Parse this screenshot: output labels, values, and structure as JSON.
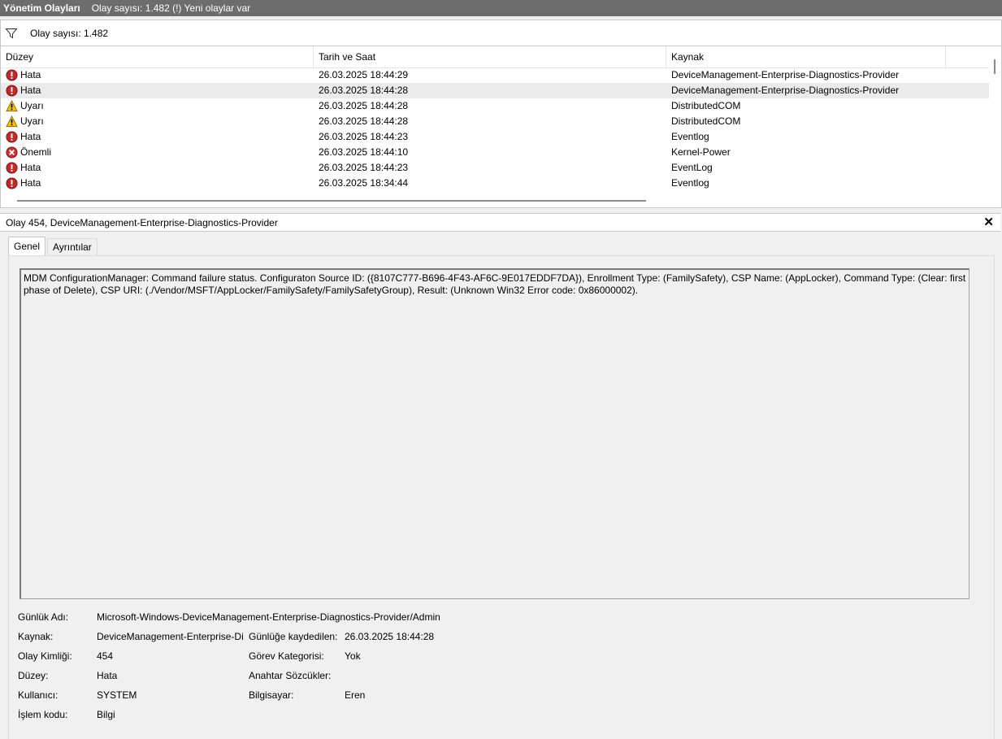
{
  "titlebar": {
    "title": "Yönetim Olayları",
    "status": "Olay sayısı: 1.482 (!) Yeni olaylar var"
  },
  "filterbar": {
    "icon": "filter-icon",
    "count_text": "Olay sayısı: 1.482"
  },
  "grid": {
    "columns": [
      "Düzey",
      "Tarih ve Saat",
      "Kaynak"
    ],
    "rows": [
      {
        "level": "Hata",
        "level_icon": "error-icon",
        "datetime": "26.03.2025 18:44:29",
        "source": "DeviceManagement-Enterprise-Diagnostics-Provider"
      },
      {
        "level": "Hata",
        "level_icon": "error-icon",
        "datetime": "26.03.2025 18:44:28",
        "source": "DeviceManagement-Enterprise-Diagnostics-Provider"
      },
      {
        "level": "Uyarı",
        "level_icon": "warning-icon",
        "datetime": "26.03.2025 18:44:28",
        "source": "DistributedCOM"
      },
      {
        "level": "Uyarı",
        "level_icon": "warning-icon",
        "datetime": "26.03.2025 18:44:28",
        "source": "DistributedCOM"
      },
      {
        "level": "Hata",
        "level_icon": "error-icon",
        "datetime": "26.03.2025 18:44:23",
        "source": "Eventlog"
      },
      {
        "level": "Önemli",
        "level_icon": "critical-icon",
        "datetime": "26.03.2025 18:44:10",
        "source": "Kernel-Power"
      },
      {
        "level": "Hata",
        "level_icon": "error-icon",
        "datetime": "26.03.2025 18:44:23",
        "source": "EventLog"
      },
      {
        "level": "Hata",
        "level_icon": "error-icon",
        "datetime": "26.03.2025 18:34:44",
        "source": "Eventlog"
      }
    ]
  },
  "detail": {
    "title": "Olay 454, DeviceManagement-Enterprise-Diagnostics-Provider",
    "close_label": "✕",
    "tabs": [
      "Genel",
      "Ayrıntılar"
    ],
    "message": "MDM ConfigurationManager: Command failure status. Configuraton Source ID: ({8107C777-B696-4F43-AF6C-9E017EDDF7DA}), Enrollment Type: (FamilySafety), CSP Name: (AppLocker), Command Type: (Clear: first phase of Delete), CSP URI: (./Vendor/MSFT/AppLocker/FamilySafety/FamilySafetyGroup), Result: (Unknown Win32 Error code: 0x86000002).",
    "props": {
      "log_name_label": "Günlük Adı:",
      "log_name": "Microsoft-Windows-DeviceManagement-Enterprise-Diagnostics-Provider/Admin",
      "source_label": "Kaynak:",
      "source": "DeviceManagement-Enterprise-Di",
      "logged_label": "Günlüğe kaydedilen:",
      "logged": "26.03.2025 18:44:28",
      "event_id_label": "Olay Kimliği:",
      "event_id": "454",
      "task_category_label": "Görev Kategorisi:",
      "task_category": "Yok",
      "level_label": "Düzey:",
      "level": "Hata",
      "keywords_label": "Anahtar Sözcükler:",
      "keywords": "",
      "user_label": "Kullanıcı:",
      "user": "SYSTEM",
      "computer_label": "Bilgisayar:",
      "computer": "Eren",
      "opcode_label": "İşlem kodu:",
      "opcode": "Bilgi"
    }
  },
  "colors": {
    "titlebar_bg": "#6d6d6d",
    "selected_row": "#ebebeb",
    "error_red": "#c62828",
    "warning_yellow": "#f5c400",
    "critical_red": "#d32f2f"
  }
}
